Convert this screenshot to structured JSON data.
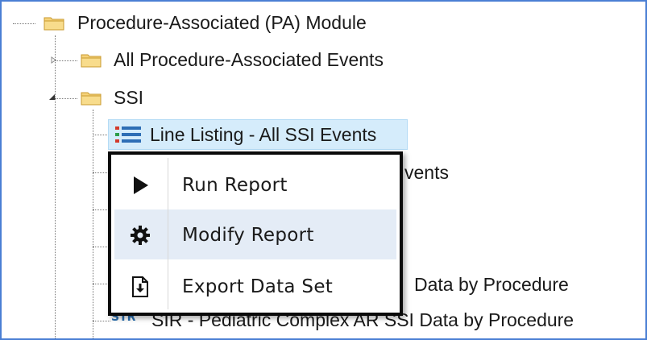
{
  "tree": {
    "module": {
      "label": "Procedure-Associated (PA) Module",
      "icon": "folder-icon"
    },
    "all_events": {
      "label": "All Procedure-Associated Events",
      "icon": "folder-icon"
    },
    "ssi": {
      "label": "SSI",
      "icon": "folder-icon"
    },
    "line_listing": {
      "label": "Line Listing - All SSI Events",
      "icon": "list-report-icon",
      "selected": true
    },
    "hidden_item_1": {
      "label_fragment": "vents"
    },
    "hidden_item_2": {
      "label_fragment": "Data by Procedure"
    },
    "sir_pediatric": {
      "badge": "STR",
      "label": "SIR - Pediatric Complex AR SSI Data by Procedure"
    }
  },
  "context_menu": {
    "items": [
      {
        "label": "Run Report",
        "icon": "play-icon"
      },
      {
        "label": "Modify Report",
        "icon": "gear-icon",
        "hovered": true
      },
      {
        "label": "Export Data Set",
        "icon": "export-file-icon"
      }
    ]
  },
  "colors": {
    "frame_border": "#4a7fd4",
    "selection_bg": "#d5ecfb",
    "menu_hover_bg": "#e4ecf6",
    "folder_yellow": "#f2c94c"
  }
}
